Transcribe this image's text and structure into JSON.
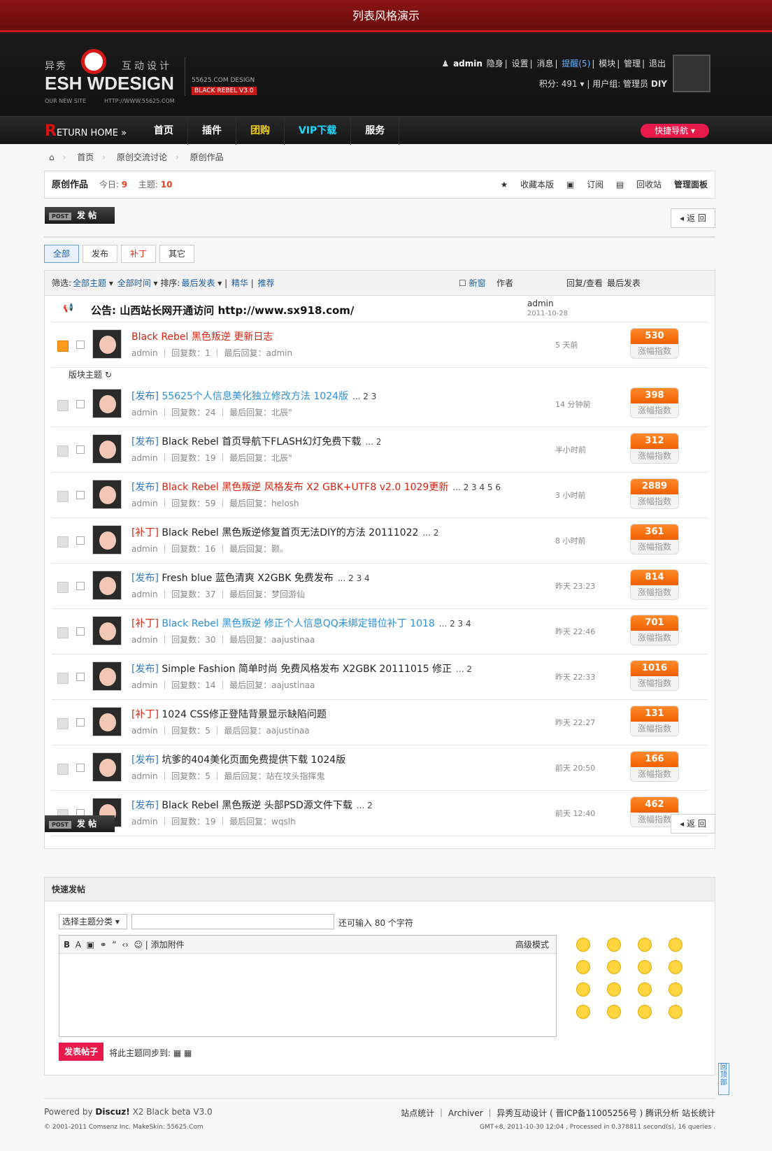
{
  "page_title": "列表风格演示",
  "logo": {
    "cn_left": "异秀",
    "cn_right": "互动设计",
    "en": "ESH WDESIGN",
    "sub": "OUR NEW SITE",
    "url": "HTTP://WWW.55625.COM",
    "design": "55625.COM DESIGN",
    "version": "BLACK REBEL V3.0"
  },
  "user": {
    "name": "admin",
    "links": [
      "隐身",
      "设置",
      "消息",
      "提醒(5)",
      "模块",
      "管理",
      "退出"
    ],
    "points": "积分: 491",
    "group": "用户组: 管理员",
    "diy": "DIY"
  },
  "nav": {
    "home": "ETURN HOME",
    "items": [
      "首页",
      "插件",
      "团购",
      "VIP下载",
      "服务"
    ],
    "quick": "快捷导航"
  },
  "crumb": [
    "首页",
    "原创交流讨论",
    "原创作品"
  ],
  "forum": {
    "name": "原创作品",
    "today_label": "今日:",
    "today": "9",
    "topics_label": "主题:",
    "topics": "10",
    "actions": [
      "收藏本版",
      "订阅",
      "回收站",
      "管理面板"
    ]
  },
  "post_label": "发 帖",
  "post_tag": "POST",
  "back_label": "返 回",
  "tabs": [
    "全部",
    "发布",
    "补丁",
    "其它"
  ],
  "filter": {
    "label": "筛选:",
    "all_topics": "全部主题",
    "all_time": "全部时间",
    "sort": "排序:",
    "last": "最后发表",
    "digest": "精华",
    "recommend": "推荐",
    "newwin": "新窗",
    "author": "作者",
    "replies": "回复/查看",
    "lastpost": "最后发表"
  },
  "announcement": {
    "label": "公告:",
    "text": "山西站长网开通访问 http://www.sx918.com/",
    "author": "admin",
    "date": "2011-10-28"
  },
  "section_label": "版块主题",
  "pot_label": "涨幅指数",
  "threads": [
    {
      "tag": "",
      "title": "Black Rebel 黑色叛逆 更新日志",
      "pages": "",
      "meta": "admin ｜ 回复数：1 ｜ 最后回复：admin",
      "time": "5 天前",
      "score": "530"
    },
    {
      "tag": "[发布]",
      "title": "55625个人信息美化独立修改方法 1024版",
      "pages": "... 2  3",
      "meta": "admin ｜ 回复数：24 ｜ 最后回复：北辰\"",
      "time": "14 分钟前",
      "score": "398"
    },
    {
      "tag": "[发布]",
      "title": "Black Rebel 首页导航下FLASH幻灯免费下载",
      "pages": "... 2",
      "meta": "admin ｜ 回复数：19 ｜ 最后回复：北辰\"",
      "time": "半小时前",
      "score": "312"
    },
    {
      "tag": "[发布]",
      "title": "Black Rebel 黑色叛逆 风格发布 X2 GBK+UTF8 v2.0 1029更新",
      "pages": "... 2  3  4  5  6",
      "meta": "admin ｜ 回复数：59 ｜ 最后回复：helosh",
      "time": "3 小时前",
      "score": "2889"
    },
    {
      "tag": "[补丁]",
      "title": "Black Rebel 黑色叛逆修复首页无法DIY的方法 20111022",
      "pages": "... 2",
      "meta": "admin ｜ 回复数：16 ｜ 最后回复：颢。",
      "time": "8 小时前",
      "score": "361"
    },
    {
      "tag": "[发布]",
      "title": "Fresh blue 蓝色清爽 X2GBK 免费发布",
      "pages": "... 2  3  4",
      "meta": "admin ｜ 回复数：37 ｜ 最后回复：梦回游仙",
      "time": "昨天 23:23",
      "score": "814"
    },
    {
      "tag": "[补丁]",
      "title": "Black Rebel 黑色叛逆 修正个人信息QQ未绑定错位补丁 1018",
      "pages": "... 2  3  4",
      "meta": "admin ｜ 回复数：30 ｜ 最后回复：aajustinaa",
      "time": "昨天 22:46",
      "score": "701"
    },
    {
      "tag": "[发布]",
      "title": "Simple Fashion 简单时尚 免费风格发布 X2GBK 20111015 修正",
      "pages": "... 2",
      "meta": "admin ｜ 回复数：14 ｜ 最后回复：aajustinaa",
      "time": "昨天 22:33",
      "score": "1016"
    },
    {
      "tag": "[补丁]",
      "title": "1024 CSS修正登陆背景显示缺陷问题",
      "pages": "",
      "meta": "admin ｜ 回复数：5 ｜ 最后回复：aajustinaa",
      "time": "昨天 22:27",
      "score": "131"
    },
    {
      "tag": "[发布]",
      "title": "坑爹的404美化页面免费提供下载 1024版",
      "pages": "",
      "meta": "admin ｜ 回复数：5 ｜ 最后回复：站在坟头指挥鬼",
      "time": "前天 20:50",
      "score": "166"
    },
    {
      "tag": "[发布]",
      "title": "Black Rebel 黑色叛逆 头部PSD源文件下载",
      "pages": "... 2",
      "meta": "admin ｜ 回复数：19 ｜ 最后回复：wqslh",
      "time": "前天 12:40",
      "score": "462"
    }
  ],
  "quick": {
    "title": "快速发帖",
    "select": "选择主题分类",
    "remain": "还可输入 80 个字符",
    "attach": "添加附件",
    "advanced": "高级模式",
    "submit": "发表帖子",
    "sync": "将此主题同步到:"
  },
  "footer": {
    "powered": "Powered by",
    "discuz": "Discuz!",
    "ver": "X2 Black beta V3.0",
    "copy": "© 2001-2011 Comsenz Inc. MakeSkin: 55625.Com",
    "links": "站点统计 ｜ Archiver ｜ 异秀互动设计 ( 晋ICP备11005256号 ) 腾讯分析 站长统计",
    "gmt": "GMT+8, 2011-10-30 12:04 , Processed in 0.378811 second(s), 16 queries ."
  },
  "totop": "回顶部"
}
